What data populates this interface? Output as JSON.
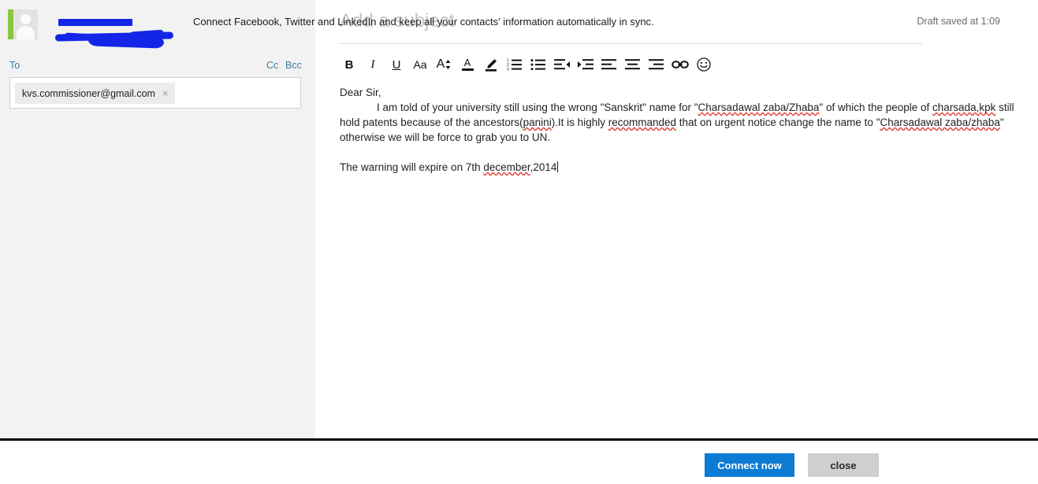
{
  "sender": {
    "avatar_icon": "person-avatar-icon",
    "name_redacted": "redacted",
    "email_redacted": "redacted",
    "redaction_color": "#1326e8"
  },
  "recipients": {
    "to_label": "To",
    "cc_label": "Cc",
    "bcc_label": "Bcc",
    "chips": [
      {
        "email": "kvs.commissioner@gmail.com",
        "remove_icon": "×"
      }
    ]
  },
  "subject": {
    "value": "",
    "placeholder": "Add a subject"
  },
  "status": {
    "draft_saved": "Draft saved at 1:09"
  },
  "toolbar": {
    "buttons": [
      {
        "name": "bold-icon",
        "label": "B",
        "title": "Bold"
      },
      {
        "name": "italic-icon",
        "label": "I",
        "title": "Italic"
      },
      {
        "name": "underline-icon",
        "label": "U",
        "title": "Underline"
      },
      {
        "name": "font-family-icon",
        "label": "Aa",
        "title": "Font"
      },
      {
        "name": "font-size-icon",
        "label": "A",
        "title": "Font size"
      },
      {
        "name": "font-color-icon",
        "label": "A",
        "title": "Text color"
      },
      {
        "name": "highlight-icon",
        "label": "",
        "title": "Highlight"
      },
      {
        "name": "numbered-list-icon",
        "label": "",
        "title": "Numbered list"
      },
      {
        "name": "bulleted-list-icon",
        "label": "",
        "title": "Bulleted list"
      },
      {
        "name": "decrease-indent-icon",
        "label": "",
        "title": "Decrease indent"
      },
      {
        "name": "increase-indent-icon",
        "label": "",
        "title": "Increase indent"
      },
      {
        "name": "align-left-icon",
        "label": "",
        "title": "Align left"
      },
      {
        "name": "align-center-icon",
        "label": "",
        "title": "Align center"
      },
      {
        "name": "align-right-icon",
        "label": "",
        "title": "Align right"
      },
      {
        "name": "link-icon",
        "label": "",
        "title": "Insert link"
      },
      {
        "name": "emoji-icon",
        "label": "",
        "title": "Insert emoticon"
      }
    ]
  },
  "body": {
    "greeting": "Dear Sir,",
    "p1_a": "I am told of your university still using the wrong \"Sanskrit\" name for \"",
    "p1_sp1": "Charsadawal zaba/Zhaba",
    "p1_b": "\" of which the people of ",
    "p1_sp2": "charsada,kpk",
    "p1_c": " still hold patents because of the ancestors(",
    "p1_sp3": "panini",
    "p1_d": ").It is highly ",
    "p1_sp4": "recommanded",
    "p1_e": " that on urgent notice change the name to \"",
    "p1_sp5": "Charsadawal zaba/zhaba",
    "p1_f": "\" otherwise we will be force to grab you to UN.",
    "p2_a": "The warning will expire on 7th ",
    "p2_sp1": "december",
    "p2_b": ",2014"
  },
  "bottom_bar": {
    "message": "Connect Facebook, Twitter and LinkedIn and keep all your contacts' information automatically in sync.",
    "connect_label": "Connect now",
    "close_label": "close",
    "connect_color": "#0b7bd4",
    "close_color": "#cfcfcf"
  }
}
